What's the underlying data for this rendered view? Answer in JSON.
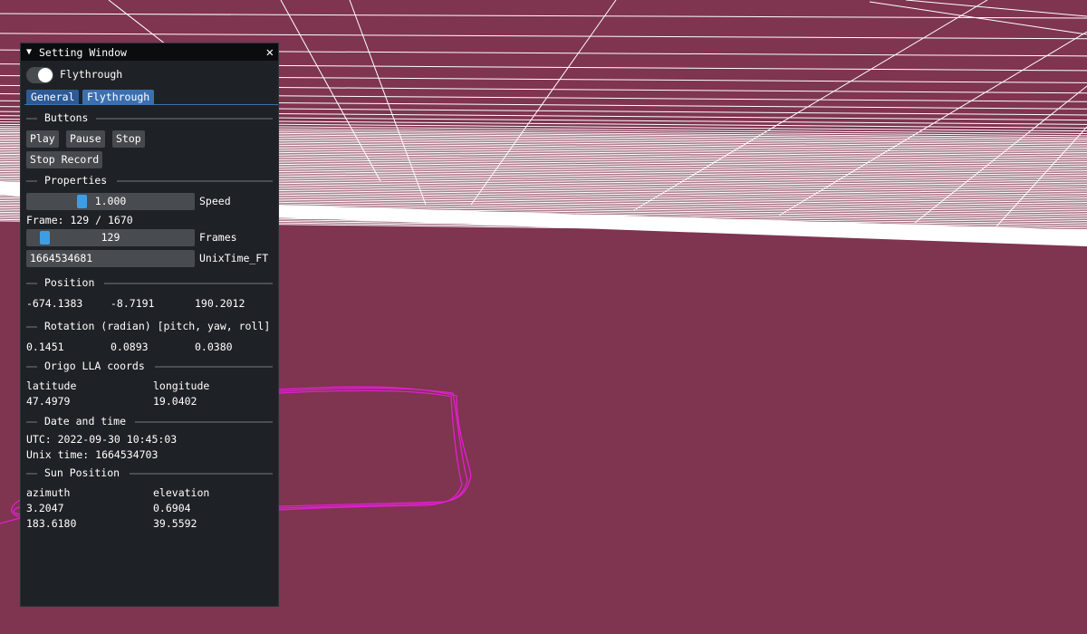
{
  "colors": {
    "background": "#7f344f",
    "grid": "#ffffff",
    "path": "#e020d0",
    "accent": "#3c6fb0",
    "slider_grab": "#3d9ee8"
  },
  "window": {
    "title": "Setting Window",
    "collapse_icon": "▼",
    "close_icon": "✕"
  },
  "toggle": {
    "label": "Flythrough",
    "on": true
  },
  "tabs": [
    {
      "label": "General",
      "active": false
    },
    {
      "label": "Flythrough",
      "active": true
    }
  ],
  "sections": {
    "buttons": "Buttons",
    "properties": "Properties",
    "position": "Position",
    "rotation": "Rotation (radian) [pitch, yaw, roll]",
    "origo": "Origo LLA coords",
    "datetime": "Date and time",
    "sun": "Sun Position"
  },
  "buttons": {
    "play": "Play",
    "pause": "Pause",
    "stop": "Stop",
    "stop_record": "Stop Record"
  },
  "properties": {
    "speed_value": "1.000",
    "speed_label": "Speed",
    "frame_text": "Frame: 129 / 1670",
    "frames_value": "129",
    "frames_label": "Frames",
    "frames_fraction": 0.077,
    "unixtime_value": "1664534681",
    "unixtime_label": "UnixTime_FT"
  },
  "position": {
    "x": "-674.1383",
    "y": "-8.7191",
    "z": "190.2012"
  },
  "rotation": {
    "pitch": "0.1451",
    "yaw": "0.0893",
    "roll": "0.0380"
  },
  "origo": {
    "lat_label": "latitude",
    "lon_label": "longitude",
    "lat": "47.4979",
    "lon": "19.0402"
  },
  "datetime": {
    "utc": "UTC: 2022-09-30 10:45:03",
    "unix": "Unix time: 1664534703"
  },
  "sun": {
    "azimuth_label": "azimuth",
    "elevation_label": "elevation",
    "azimuth_rad": "3.2047",
    "elevation_rad": "0.6904",
    "azimuth_deg": "183.6180",
    "elevation_deg": "39.5592"
  }
}
